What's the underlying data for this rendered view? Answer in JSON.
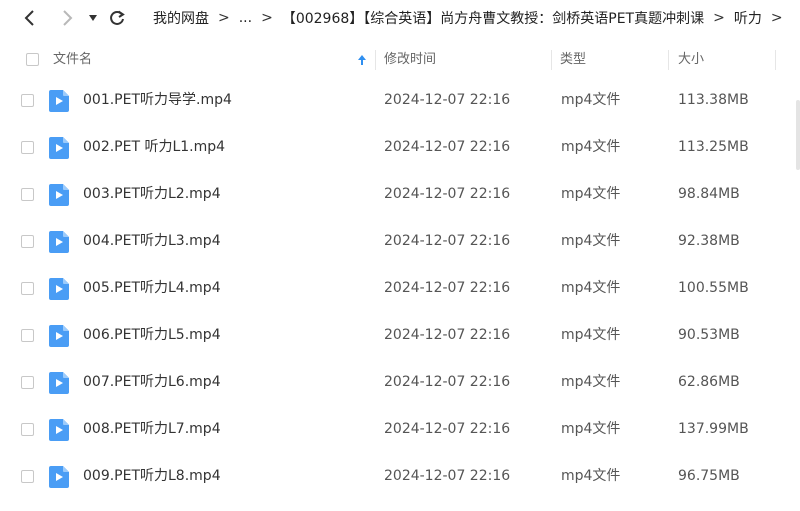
{
  "breadcrumb": {
    "root": "我的网盘",
    "ellipsis": "...",
    "folder": "【002968】【综合英语】尚方舟曹文教授：剑桥英语PET真题冲刺课",
    "current": "听力"
  },
  "columns": {
    "name": "文件名",
    "modified": "修改时间",
    "type": "类型",
    "size": "大小"
  },
  "files": [
    {
      "name": "001.PET听力导学.mp4",
      "modified": "2024-12-07 22:16",
      "type": "mp4文件",
      "size": "113.38MB"
    },
    {
      "name": "002.PET 听力L1.mp4",
      "modified": "2024-12-07 22:16",
      "type": "mp4文件",
      "size": "113.25MB"
    },
    {
      "name": "003.PET听力L2.mp4",
      "modified": "2024-12-07 22:16",
      "type": "mp4文件",
      "size": "98.84MB"
    },
    {
      "name": "004.PET听力L3.mp4",
      "modified": "2024-12-07 22:16",
      "type": "mp4文件",
      "size": "92.38MB"
    },
    {
      "name": "005.PET听力L4.mp4",
      "modified": "2024-12-07 22:16",
      "type": "mp4文件",
      "size": "100.55MB"
    },
    {
      "name": "006.PET听力L5.mp4",
      "modified": "2024-12-07 22:16",
      "type": "mp4文件",
      "size": "90.53MB"
    },
    {
      "name": "007.PET听力L6.mp4",
      "modified": "2024-12-07 22:16",
      "type": "mp4文件",
      "size": "62.86MB"
    },
    {
      "name": "008.PET听力L7.mp4",
      "modified": "2024-12-07 22:16",
      "type": "mp4文件",
      "size": "137.99MB"
    },
    {
      "name": "009.PET听力L8.mp4",
      "modified": "2024-12-07 22:16",
      "type": "mp4文件",
      "size": "96.75MB"
    }
  ],
  "icons": {
    "back": "arrow-left-icon",
    "forward": "arrow-right-icon",
    "history": "caret-down-icon",
    "refresh": "refresh-icon",
    "sort": "sort-ascending-icon",
    "file": "video-file-icon"
  },
  "colors": {
    "accent": "#2f8ff0",
    "file_icon": "#4a9df5"
  }
}
